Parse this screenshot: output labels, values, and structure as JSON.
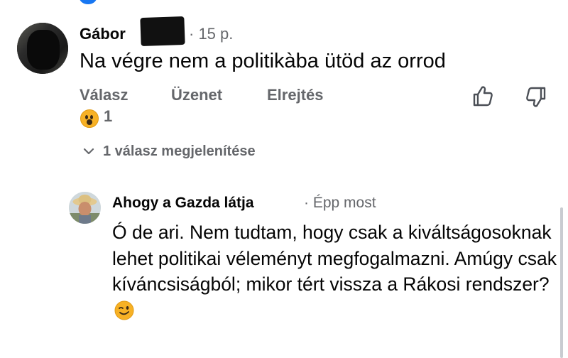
{
  "comment": {
    "author_visible": "Gábor",
    "time": "· 15 p.",
    "text": "Na végre nem a politikàba ütöd az orrod",
    "actions": {
      "reply": "Válasz",
      "message": "Üzenet",
      "hide": "Elrejtés"
    },
    "reaction": {
      "emoji": "wow",
      "count": "1"
    },
    "show_replies": "1 válasz megjelenítése"
  },
  "reply": {
    "author": "Ahogy a Gazda látja",
    "time": "· Épp most",
    "text": "Ó de ari. Nem tudtam, hogy csak a kiváltságosoknak lehet politikai véleményt megfogalmazni. Amúgy csak kíváncsiságból; mikor tért vissza a Rákosi rendszer?",
    "emoji": "winking-face"
  },
  "icons": [
    "like-icon",
    "dislike-icon",
    "chevron-down-icon"
  ],
  "colors": {
    "muted": "#65676b",
    "text": "#050505",
    "reaction": "#f7b125"
  }
}
